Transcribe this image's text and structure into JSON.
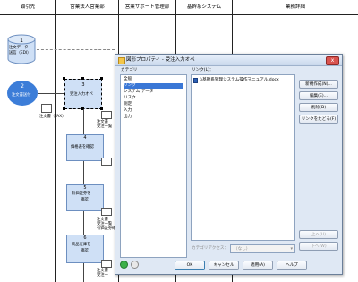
{
  "lanes": [
    {
      "label": "顧引先"
    },
    {
      "label": "営業法人営業部"
    },
    {
      "label": "営業サポート管理部"
    },
    {
      "label": "基幹系システム"
    },
    {
      "label": "業務詳細"
    }
  ],
  "flow": {
    "node1_num": "1",
    "node1_text_a": "注文データ",
    "node1_text_b": "送信（EDI）",
    "node2_num": "2",
    "node2_text": "注文書送付",
    "doc1_label": "注文書（FAX）",
    "box3_num": "3",
    "box3_text": "受注入力オペ",
    "doc2_label_a": "注文書",
    "doc2_label_b": "受注一覧",
    "box4_num": "4",
    "box4_text": "価格表を確認",
    "box5_num": "5",
    "box5_text_a": "有価証券を",
    "box5_text_b": "確認",
    "doc3_label_a": "注文書",
    "doc3_label_b": "受注一覧",
    "doc3_label_c": "有価証券確",
    "box6_num": "6",
    "box6_text_a": "商品在庫を",
    "box6_text_b": "確認",
    "doc4_label_a": "注文書",
    "doc4_label_b": "受注一"
  },
  "dialog": {
    "title": "図形プロパティ - 受注入力オペ",
    "close_label": "x",
    "category_label": "カテゴリ",
    "categories": [
      "全般",
      "リンク",
      "システム データ",
      "リスク",
      "測定",
      "入力",
      "出力"
    ],
    "link_label": "リンク(L)：",
    "link_item": "\\\\基幹系管理システム操作マニュアル.docx",
    "buttons": {
      "new": "新規作成(N)...",
      "edit": "編集(E)...",
      "delete": "削除(D)",
      "follow": "リンクをたどる(F)",
      "up": "上へ(U)",
      "down": "下へ(W)"
    },
    "category_access_label": "カテゴリアクセス：",
    "category_access_value": "（なし）",
    "ok": "OK",
    "cancel": "キャンセル",
    "apply": "適用(A)",
    "help": "ヘルプ"
  }
}
